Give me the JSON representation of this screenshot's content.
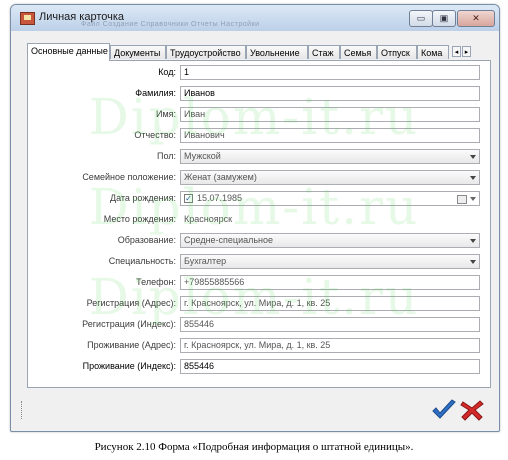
{
  "window": {
    "title": "Личная карточка",
    "menu_ghost": "Файл    Создание    Справочники    Отчеты    Настройки",
    "min_glyph": "▭",
    "max_glyph": "▣",
    "close_glyph": "✕"
  },
  "tabs": [
    {
      "label": "Основные данные",
      "active": true
    },
    {
      "label": "Документы"
    },
    {
      "label": "Трудоустройство"
    },
    {
      "label": "Увольнение"
    },
    {
      "label": "Стаж"
    },
    {
      "label": "Семья"
    },
    {
      "label": "Отпуск"
    },
    {
      "label": "Кома"
    }
  ],
  "tab_scroll": {
    "left": "◂",
    "right": "▸"
  },
  "form": {
    "code": {
      "label": "Код:",
      "value": "1"
    },
    "surname": {
      "label": "Фамилия:",
      "value": "Иванов"
    },
    "name": {
      "label": "Имя:",
      "value": "Иван"
    },
    "patronymic": {
      "label": "Отчество:",
      "value": "Иванович"
    },
    "gender": {
      "label": "Пол:",
      "value": "Мужской"
    },
    "marital": {
      "label": "Семейное положение:",
      "value": "Женат (замужем)"
    },
    "birthdate": {
      "label": "Дата рождения:",
      "value": "15.07.1985",
      "check": "✓"
    },
    "birthplace": {
      "label": "Место рождения:",
      "value": "Красноярск"
    },
    "education": {
      "label": "Образование:",
      "value": "Средне-специальное"
    },
    "specialty": {
      "label": "Специальность:",
      "value": "Бухгалтер"
    },
    "phone": {
      "label": "Телефон:",
      "value": "+79855885566"
    },
    "reg_address": {
      "label": "Регистрация (Адрес):",
      "value": "г. Красноярск, ул. Мира, д. 1, кв. 25"
    },
    "reg_index": {
      "label": "Регистрация (Индекс):",
      "value": "855446"
    },
    "live_address": {
      "label": "Проживание (Адрес):",
      "value": "г. Красноярск, ул. Мира, д. 1, кв. 25"
    },
    "live_index": {
      "label": "Проживание (Индекс):",
      "value": "855446"
    }
  },
  "toolbar": {
    "ok_icon": "checkmark-icon",
    "cancel_icon": "red-x-icon"
  },
  "watermark": "Diplom-it.ru",
  "caption": "Рисунок 2.10  Форма «Подробная информация о штатной единицы».",
  "colors": {
    "ok": "#2f6fc4",
    "cancel": "#d42a2a",
    "watermark": "#3cc83c"
  }
}
